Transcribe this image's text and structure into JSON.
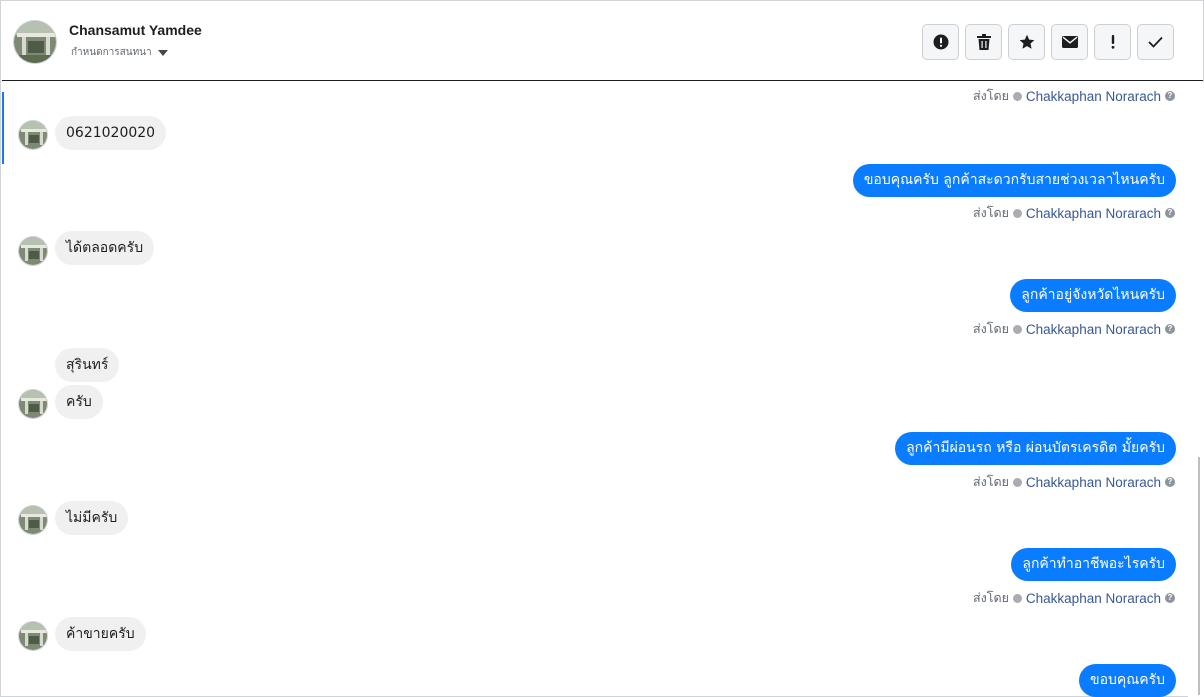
{
  "header": {
    "contact_name": "Chansamut Yamdee",
    "subtitle": "กำหนดการสนทนา",
    "actions": [
      {
        "icon": "alert-circle-icon",
        "tooltip": ""
      },
      {
        "icon": "trash-icon",
        "tooltip": ""
      },
      {
        "icon": "star-icon",
        "tooltip": ""
      },
      {
        "icon": "envelope-icon",
        "tooltip": ""
      },
      {
        "icon": "exclamation-icon",
        "tooltip": ""
      },
      {
        "icon": "checkmark-icon",
        "tooltip": ""
      }
    ]
  },
  "sent_by_label": "ส่งโดย",
  "agent_name": "Chakkaphan Norarach",
  "messages": {
    "in_1": "0621020020",
    "out_1": "ขอบคุณครับ ลูกค้าสะดวกรับสายช่วงเวลาไหนครับ",
    "in_2": "ได้ตลอดครับ",
    "out_2": "ลูกค้าอยู่จังหวัดไหนครับ",
    "in_3a": "สุรินทร์",
    "in_3b": "ครับ",
    "out_3": "ลูกค้ามีผ่อนรถ หรือ ผ่อนบัตรเครดิต มั้ยครับ",
    "in_4": "ไม่มีครับ",
    "out_4": "ลูกค้าทำอาชีพอะไรครับ",
    "in_5": "ค้าขายครับ",
    "out_5": "ขอบคุณครับ"
  },
  "colors": {
    "outgoing_bubble": "#0a7cff",
    "incoming_bubble": "#f0f0f0",
    "agent_link": "#385898"
  }
}
